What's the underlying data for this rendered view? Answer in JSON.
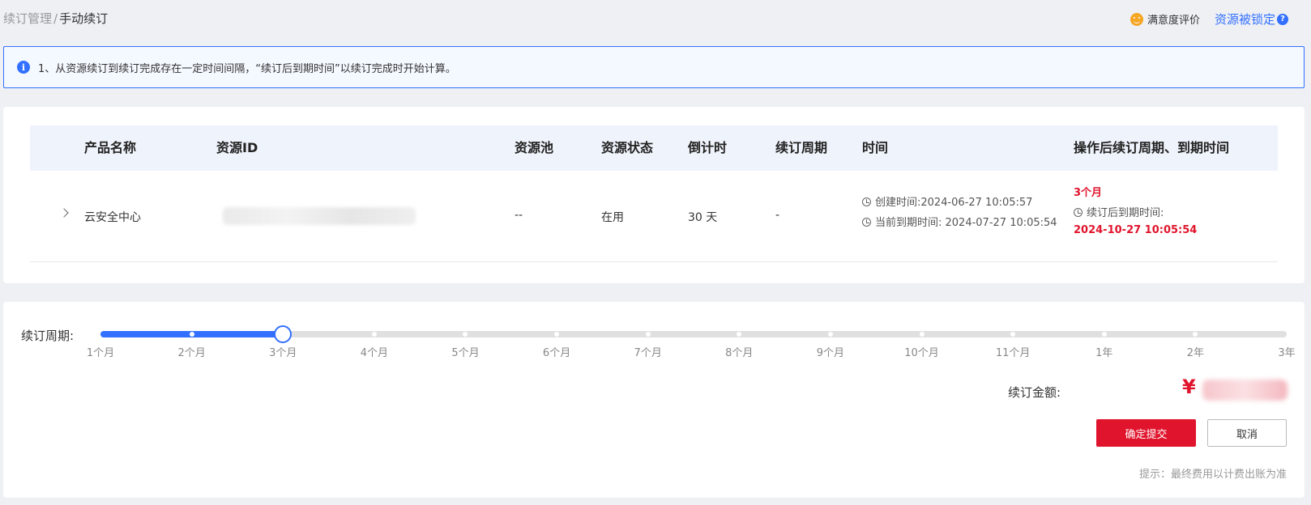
{
  "breadcrumb": {
    "parent": "续订管理",
    "separator": "/",
    "current": "手动续订"
  },
  "top_right": {
    "rating_label": "满意度评价",
    "lock_link": "资源被锁定",
    "help_symbol": "?"
  },
  "notice": {
    "icon": "i",
    "text": "1、从资源续订到续订完成存在一定时间间隔，“续订后到期时间”以续订完成时开始计算。"
  },
  "table": {
    "headers": [
      "产品名称",
      "资源ID",
      "资源池",
      "资源状态",
      "倒计时",
      "续订周期",
      "时间",
      "操作后续订周期、到期时间"
    ],
    "row": {
      "product": "云安全中心",
      "pool": "--",
      "status": "在用",
      "countdown": "30 天",
      "period": "-",
      "created": "创建时间:2024-06-27 10:05:57",
      "current_expiry": "当前到期时间: 2024-07-27 10:05:54",
      "new_period": "3个月",
      "after_label": "续订后到期时间:",
      "after_time": "2024-10-27 10:05:54"
    }
  },
  "renew": {
    "label": "续订周期:",
    "options": [
      "1个月",
      "2个月",
      "3个月",
      "4个月",
      "5个月",
      "6个月",
      "7个月",
      "8个月",
      "9个月",
      "10个月",
      "11个月",
      "1年",
      "2年",
      "3年"
    ],
    "selected_index": 2,
    "amount_label": "续订金额:",
    "currency": "¥",
    "submit_label": "确定提交",
    "cancel_label": "取消",
    "hint": "提示：最终费用以计费出账为准"
  },
  "colors": {
    "accent": "#3370ff",
    "danger": "#e0152d"
  }
}
